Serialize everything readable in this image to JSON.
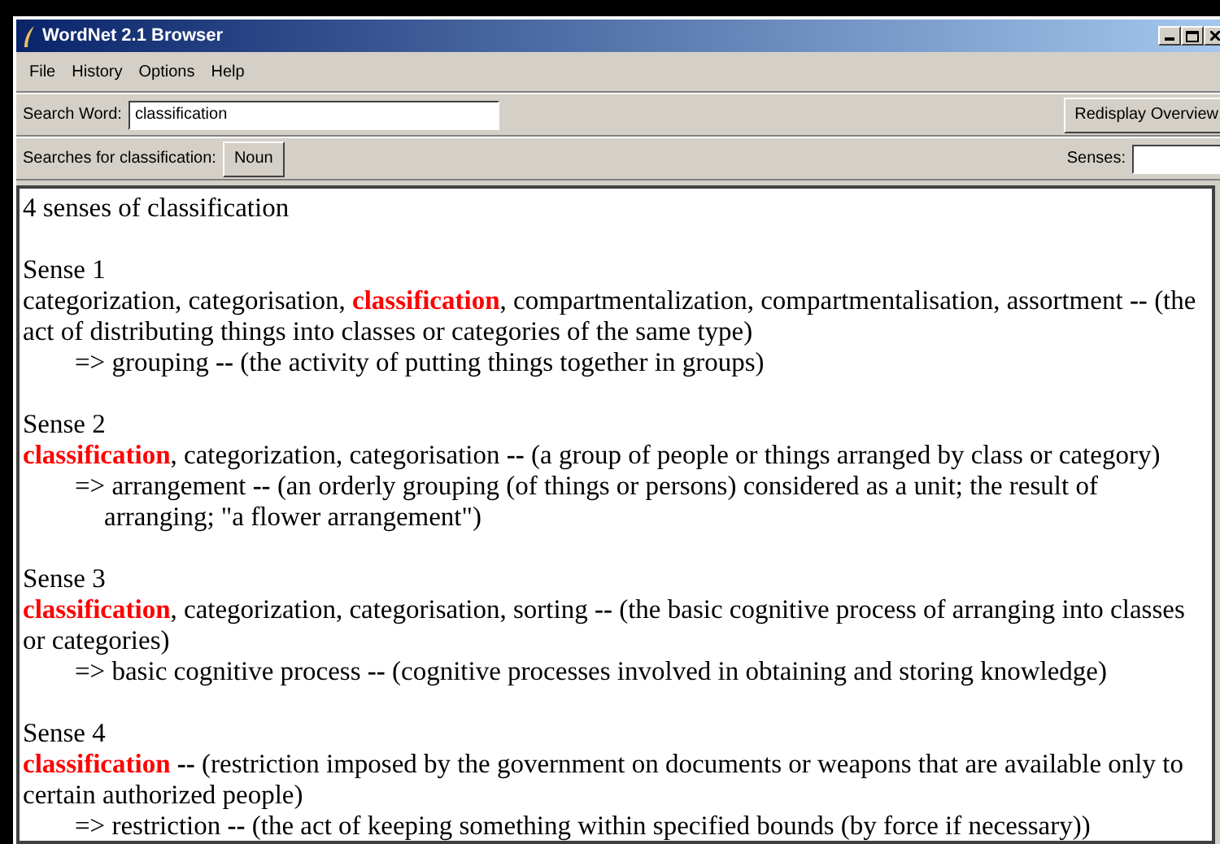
{
  "window": {
    "title": "WordNet 2.1 Browser"
  },
  "menu": [
    "File",
    "History",
    "Options",
    "Help"
  ],
  "search": {
    "label": "Search Word:",
    "value": "classification",
    "button": "Redisplay Overview"
  },
  "searches": {
    "label": "Searches for classification:",
    "buttons": [
      "Noun"
    ],
    "senses_label": "Senses:"
  },
  "results": {
    "heading": "4 senses of classification",
    "senses": [
      {
        "title": "Sense 1",
        "synset": [
          {
            "kind": "plain",
            "text": "categorization, categorisation, "
          },
          {
            "kind": "head",
            "text": "classification"
          },
          {
            "kind": "plain",
            "text": ", compartmentalization, compartmentalisation, assortment **--** (the act of distributing things into classes or categories of the same type)"
          }
        ],
        "hypernym": "=> grouping **--** (the activity of putting things together in groups)"
      },
      {
        "title": "Sense 2",
        "synset": [
          {
            "kind": "head",
            "text": "classification"
          },
          {
            "kind": "plain",
            "text": ", categorization, categorisation **--** (a group of people or things arranged by class or category)"
          }
        ],
        "hypernym": "=> arrangement **--** (an orderly grouping (of things or persons) considered as a unit; the result of arranging; \"a flower arrangement\")"
      },
      {
        "title": "Sense 3",
        "synset": [
          {
            "kind": "head",
            "text": "classification"
          },
          {
            "kind": "plain",
            "text": ", categorization, categorisation, sorting **--** (the basic cognitive process of arranging into classes or categories)"
          }
        ],
        "hypernym": "=> basic cognitive process **--** (cognitive processes involved in obtaining and storing knowledge)"
      },
      {
        "title": "Sense 4",
        "synset": [
          {
            "kind": "head",
            "text": "classification"
          },
          {
            "kind": "plain",
            "text": " **--** (restriction imposed by the government on documents or weapons that are available only to certain authorized people)"
          }
        ],
        "hypernym": "=> restriction **--** (the act of keeping something within specified bounds (by force if necessary))"
      }
    ]
  }
}
